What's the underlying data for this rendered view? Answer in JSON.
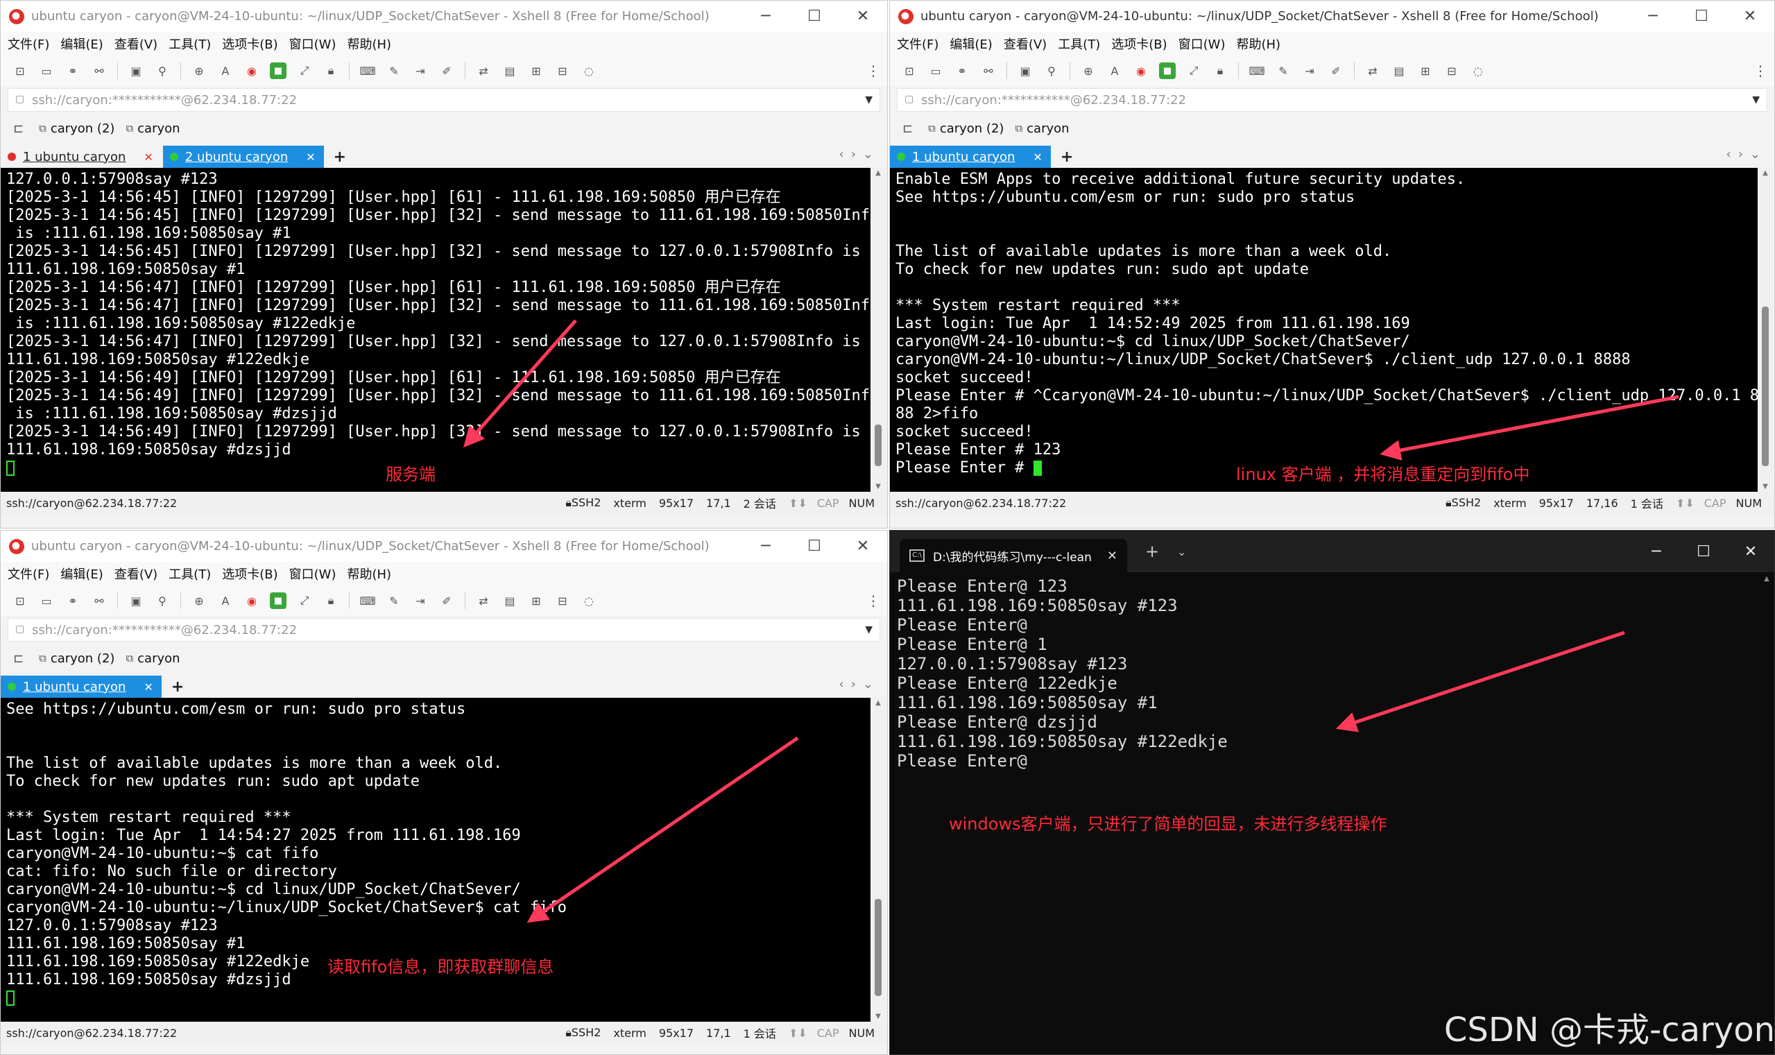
{
  "common": {
    "menu": [
      "文件(F)",
      "编辑(E)",
      "查看(V)",
      "工具(T)",
      "选项卡(B)",
      "窗口(W)",
      "帮助(H)"
    ],
    "address": "ssh://caryon:***********@62.234.18.77:22",
    "links": [
      "caryon (2)",
      "caryon"
    ]
  },
  "w1": {
    "title": "ubuntu caryon - caryon@VM-24-10-ubuntu: ~/linux/UDP_Socket/ChatSever - Xshell 8 (Free for Home/School)",
    "tabs": [
      "1 ubuntu caryon",
      "2 ubuntu caryon"
    ],
    "terminal": "127.0.0.1:57908say #123\n[2025-3-1 14:56:45] [INFO] [1297299] [User.hpp] [61] - 111.61.198.169:50850 用户已存在\n[2025-3-1 14:56:45] [INFO] [1297299] [User.hpp] [32] - send message to 111.61.198.169:50850Info\n is :111.61.198.169:50850say #1\n[2025-3-1 14:56:45] [INFO] [1297299] [User.hpp] [32] - send message to 127.0.0.1:57908Info is :\n111.61.198.169:50850say #1\n[2025-3-1 14:56:47] [INFO] [1297299] [User.hpp] [61] - 111.61.198.169:50850 用户已存在\n[2025-3-1 14:56:47] [INFO] [1297299] [User.hpp] [32] - send message to 111.61.198.169:50850Info\n is :111.61.198.169:50850say #122edkje\n[2025-3-1 14:56:47] [INFO] [1297299] [User.hpp] [32] - send message to 127.0.0.1:57908Info is :\n111.61.198.169:50850say #122edkje\n[2025-3-1 14:56:49] [INFO] [1297299] [User.hpp] [61] - 111.61.198.169:50850 用户已存在\n[2025-3-1 14:56:49] [INFO] [1297299] [User.hpp] [32] - send message to 111.61.198.169:50850Info\n is :111.61.198.169:50850say #dzsjjd\n[2025-3-1 14:56:49] [INFO] [1297299] [User.hpp] [32] - send message to 127.0.0.1:57908Info is :\n111.61.198.169:50850say #dzsjjd",
    "annotation": "服务端",
    "status": {
      "addr": "ssh://caryon@62.234.18.77:22",
      "proto": "SSH2",
      "term": "xterm",
      "size": "95x17",
      "pos": "17,1",
      "sessions": "2 会话",
      "cap": "CAP",
      "num": "NUM"
    }
  },
  "w2": {
    "title": "ubuntu caryon - caryon@VM-24-10-ubuntu: ~/linux/UDP_Socket/ChatSever - Xshell 8 (Free for Home/School)",
    "tabs": [
      "1 ubuntu caryon"
    ],
    "terminal": "Enable ESM Apps to receive additional future security updates.\nSee https://ubuntu.com/esm or run: sudo pro status\n\n\nThe list of available updates is more than a week old.\nTo check for new updates run: sudo apt update\n\n*** System restart required ***\nLast login: Tue Apr  1 14:52:49 2025 from 111.61.198.169\ncaryon@VM-24-10-ubuntu:~$ cd linux/UDP_Socket/ChatSever/\ncaryon@VM-24-10-ubuntu:~/linux/UDP_Socket/ChatSever$ ./client_udp 127.0.0.1 8888\nsocket succeed!\nPlease Enter # ^Ccaryon@VM-24-10-ubuntu:~/linux/UDP_Socket/ChatSever$ ./client_udp 127.0.0.1 88\n88 2>fifo\nsocket succeed!\nPlease Enter # 123\nPlease Enter # ",
    "annotation": "linux 客户端 ，并将消息重定向到fifo中",
    "status": {
      "addr": "ssh://caryon@62.234.18.77:22",
      "proto": "SSH2",
      "term": "xterm",
      "size": "95x17",
      "pos": "17,16",
      "sessions": "1 会话",
      "cap": "CAP",
      "num": "NUM"
    }
  },
  "w3": {
    "title": "ubuntu caryon - caryon@VM-24-10-ubuntu: ~/linux/UDP_Socket/ChatSever - Xshell 8 (Free for Home/School)",
    "tabs": [
      "1 ubuntu caryon"
    ],
    "terminal": "See https://ubuntu.com/esm or run: sudo pro status\n\n\nThe list of available updates is more than a week old.\nTo check for new updates run: sudo apt update\n\n*** System restart required ***\nLast login: Tue Apr  1 14:54:27 2025 from 111.61.198.169\ncaryon@VM-24-10-ubuntu:~$ cat fifo\ncat: fifo: No such file or directory\ncaryon@VM-24-10-ubuntu:~$ cd linux/UDP_Socket/ChatSever/\ncaryon@VM-24-10-ubuntu:~/linux/UDP_Socket/ChatSever$ cat fifo\n127.0.0.1:57908say #123\n111.61.198.169:50850say #1\n111.61.198.169:50850say #122edkje\n111.61.198.169:50850say #dzsjjd",
    "annotation": "读取fifo信息，即获取群聊信息",
    "status": {
      "addr": "ssh://caryon@62.234.18.77:22",
      "proto": "SSH2",
      "term": "xterm",
      "size": "95x17",
      "pos": "17,1",
      "sessions": "1 会话",
      "cap": "CAP",
      "num": "NUM"
    }
  },
  "w4": {
    "tab_title": "D:\\我的代码练习\\my---c-lean",
    "terminal": "Please Enter@ 123\n111.61.198.169:50850say #123\nPlease Enter@\nPlease Enter@ 1\n127.0.0.1:57908say #123\nPlease Enter@ 122edkje\n111.61.198.169:50850say #1\nPlease Enter@ dzsjjd\n111.61.198.169:50850say #122edkje\nPlease Enter@",
    "annotation": "windows客户端，只进行了简单的回显，未进行多线程操作",
    "watermark": "CSDN @卡戎-caryon"
  },
  "colors": {
    "accent": "#1e8fe0",
    "annotation": "#ff2a3a",
    "cursor": "#2ee62e"
  }
}
